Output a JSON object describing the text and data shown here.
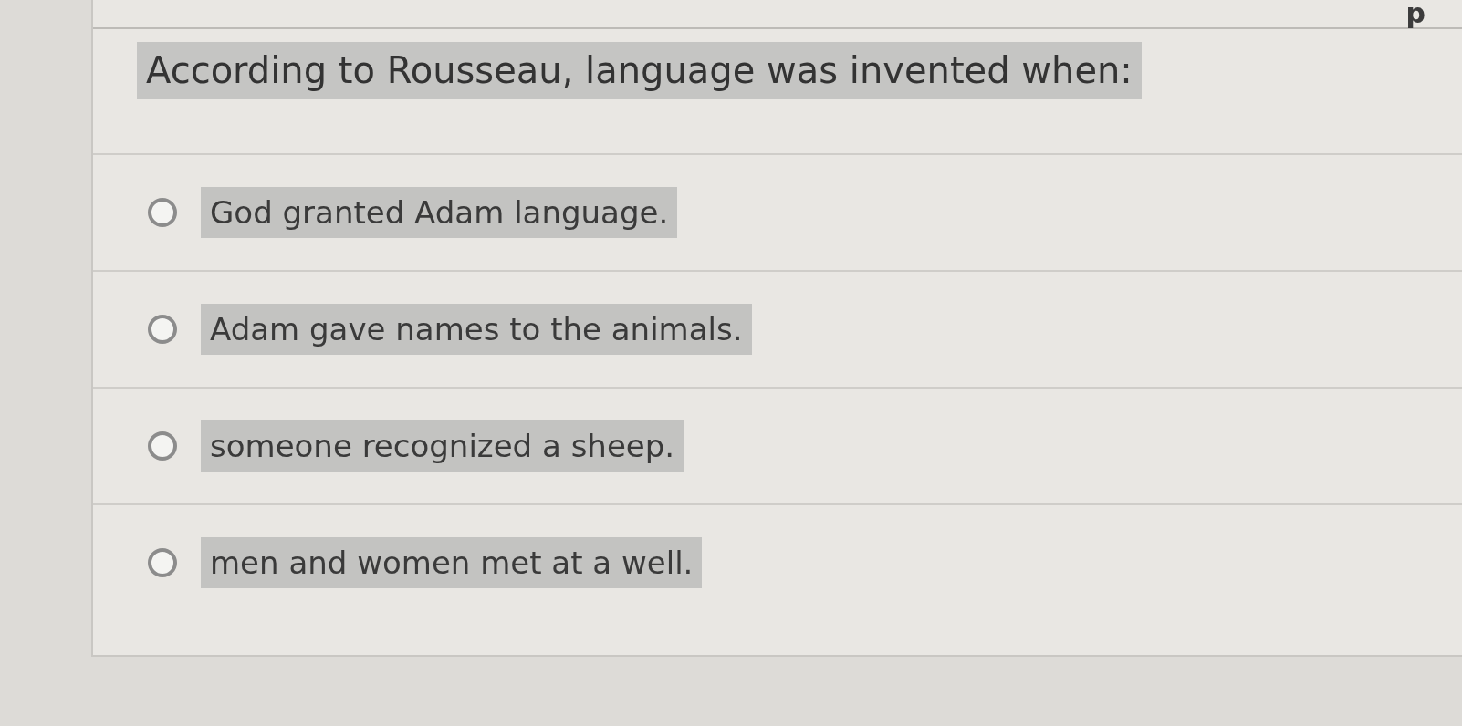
{
  "points": {
    "text": "p"
  },
  "question": {
    "text": "According to Rousseau, language was invented when:",
    "highlighted": true
  },
  "options": [
    {
      "label": "God granted Adam language.",
      "selected": false,
      "highlighted": true
    },
    {
      "label": "Adam gave names to the animals.",
      "selected": false,
      "highlighted": true
    },
    {
      "label": "someone recognized a sheep.",
      "selected": false,
      "highlighted": true
    },
    {
      "label": "men and women met at a well.",
      "selected": false,
      "highlighted": true
    }
  ]
}
